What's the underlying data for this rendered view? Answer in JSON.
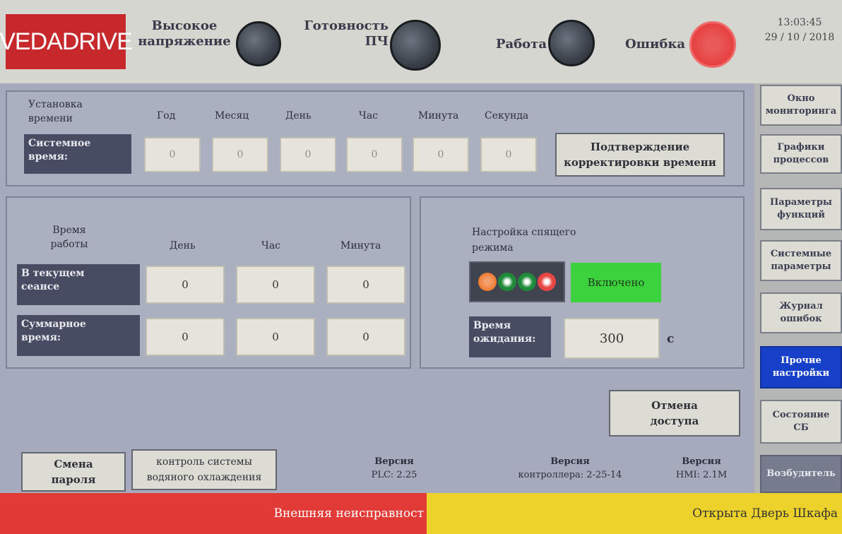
{
  "header": {
    "logo": "VEDADRIVE",
    "indicators": [
      {
        "label_l1": "Высокое",
        "label_l2": "напряжение",
        "state": "off"
      },
      {
        "label_l1": "Готовность",
        "label_l2": "ПЧ",
        "state": "off"
      },
      {
        "label_l1": "Работа",
        "label_l2": "",
        "state": "off"
      },
      {
        "label_l1": "Ошибка",
        "label_l2": "",
        "state": "on"
      }
    ],
    "time": "13:03:45",
    "date": "29 / 10 / 2018"
  },
  "time_setting": {
    "title_l1": "Установка",
    "title_l2": "времени",
    "columns": [
      "Год",
      "Месяц",
      "День",
      "Час",
      "Минута",
      "Секунда"
    ],
    "row_label_l1": "Системное",
    "row_label_l2": "время:",
    "values": [
      "0",
      "0",
      "0",
      "0",
      "0",
      "0"
    ],
    "confirm_l1": "Подтверждение",
    "confirm_l2": "корректировки времени"
  },
  "run_time": {
    "title_l1": "Время",
    "title_l2": "работы",
    "columns": [
      "День",
      "Час",
      "Минута"
    ],
    "rows": [
      {
        "label_l1": "В текущем",
        "label_l2": "сеансе",
        "values": [
          "0",
          "0",
          "0"
        ]
      },
      {
        "label_l1": "Суммарное",
        "label_l2": "время:",
        "values": [
          "0",
          "0",
          "0"
        ]
      }
    ]
  },
  "sleep": {
    "title_l1": "Настройка спящего",
    "title_l2": "режима",
    "lamp_colors": [
      "#f07830",
      "#1f8a3a",
      "#1f8a3a",
      "#e84545"
    ],
    "status": "Включено",
    "wait_label_l1": "Время",
    "wait_label_l2": "ожидания:",
    "wait_value": "300",
    "wait_unit": "с"
  },
  "cancel_access": {
    "l1": "Отмена",
    "l2": "доступа"
  },
  "bottom": {
    "change_password": {
      "l1": "Смена",
      "l2": "пароля"
    },
    "water_cooling": {
      "l1": "контроль системы",
      "l2": "водяного охлаждения"
    },
    "versions": [
      {
        "l1": "Версия",
        "l2": "PLC: 2.25"
      },
      {
        "l1": "Версия",
        "l2": "контроллера: 2-25-14"
      },
      {
        "l1": "Версия",
        "l2": "HMI: 2.1M"
      }
    ]
  },
  "sidebar": [
    {
      "l1": "Окно",
      "l2": "мониторинга"
    },
    {
      "l1": "Графики",
      "l2": "процессов"
    },
    {
      "l1": "Параметры",
      "l2": "функций"
    },
    {
      "l1": "Системные",
      "l2": "параметры"
    },
    {
      "l1": "Журнал",
      "l2": "ошибок"
    },
    {
      "l1": "Прочие",
      "l2": "настройки"
    },
    {
      "l1": "Состояние",
      "l2": "СБ"
    },
    {
      "l1": "Возбудитель",
      "l2": ""
    }
  ],
  "alarms": {
    "left": "Внешняя неисправност",
    "right": "Открыта Дверь Шкафа"
  }
}
